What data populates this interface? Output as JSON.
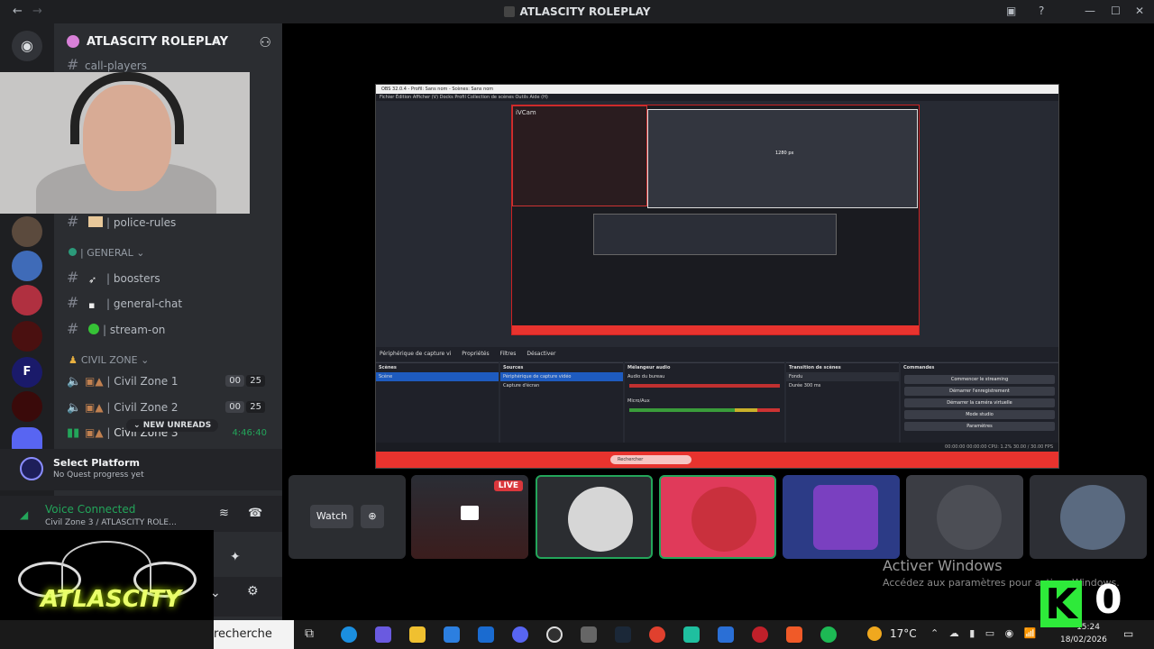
{
  "window": {
    "title": "ATLASCITY ROLEPLAY"
  },
  "server": {
    "name": "ATLASCITY ROLEPLAY"
  },
  "channels": {
    "top_partial": "call-players",
    "police_rules": "police-rules",
    "category_general": "GENERAL",
    "boosters": "boosters",
    "general_chat": "general-chat",
    "stream_on": "stream-on",
    "category_civil": "CIVIL ZONE",
    "civil1": {
      "name": "Civil Zone 1",
      "count_a": "00",
      "count_b": "25"
    },
    "civil2": {
      "name": "Civil Zone 2",
      "count_a": "00",
      "count_b": "25"
    },
    "civil3": {
      "name": "Civil Zone 3",
      "timer": "4:46:40"
    },
    "new_unreads": "NEW UNREADS"
  },
  "quest": {
    "title": "Select Platform",
    "subtitle": "No Quest progress yet"
  },
  "voice": {
    "status": "Voice Connected",
    "location": "Civil Zone 3 / ATLASCITY ROLE..."
  },
  "logo_text": "ATLASCITY",
  "stage": {
    "watch_label": "Watch",
    "live_label": "LIVE"
  },
  "obs": {
    "title": "OBS 32.0.4 - Profil: Sans nom - Scènes: Sans nom",
    "menu": "Fichier   Édition   Afficher (V)   Docks   Profil   Collection de scènes   Outils   Aide (H)",
    "preview_label": "iVCam",
    "preview_px": "1280 px",
    "source_bar": [
      "Périphérique de capture vi",
      "Propriétés",
      "Filtres",
      "Désactiver"
    ],
    "scenes_header": "Scènes",
    "scene_item": "Scène",
    "sources_header": "Sources",
    "source_items": [
      "Périphérique de capture vidéo",
      "Capture d'écran"
    ],
    "mixer_header": "Mélangeur audio",
    "mixer_items": [
      "Audio du bureau",
      "Micro/Aux"
    ],
    "transitions_header": "Transition de scènes",
    "transition_value": "Fondu",
    "duration_label": "Durée",
    "duration_value": "300 ms",
    "controls_header": "Commandes",
    "controls": [
      "Commencer le streaming",
      "Démarrer l'enregistrement",
      "Démarrer la caméra virtuelle",
      "Mode studio",
      "Paramètres"
    ],
    "status": "00:00:00   00:00:00   CPU: 1.2%   30.00 / 30.00 FPS",
    "taskbar_search": "Rechercher"
  },
  "activate": {
    "title": "Activer Windows",
    "subtitle": "Accédez aux paramètres pour activer Windows."
  },
  "overlay": {
    "k": "K",
    "zero": "0"
  },
  "taskbar": {
    "search": "recherche",
    "weather": "17°C",
    "time": "15:24",
    "date": "18/02/2026"
  }
}
